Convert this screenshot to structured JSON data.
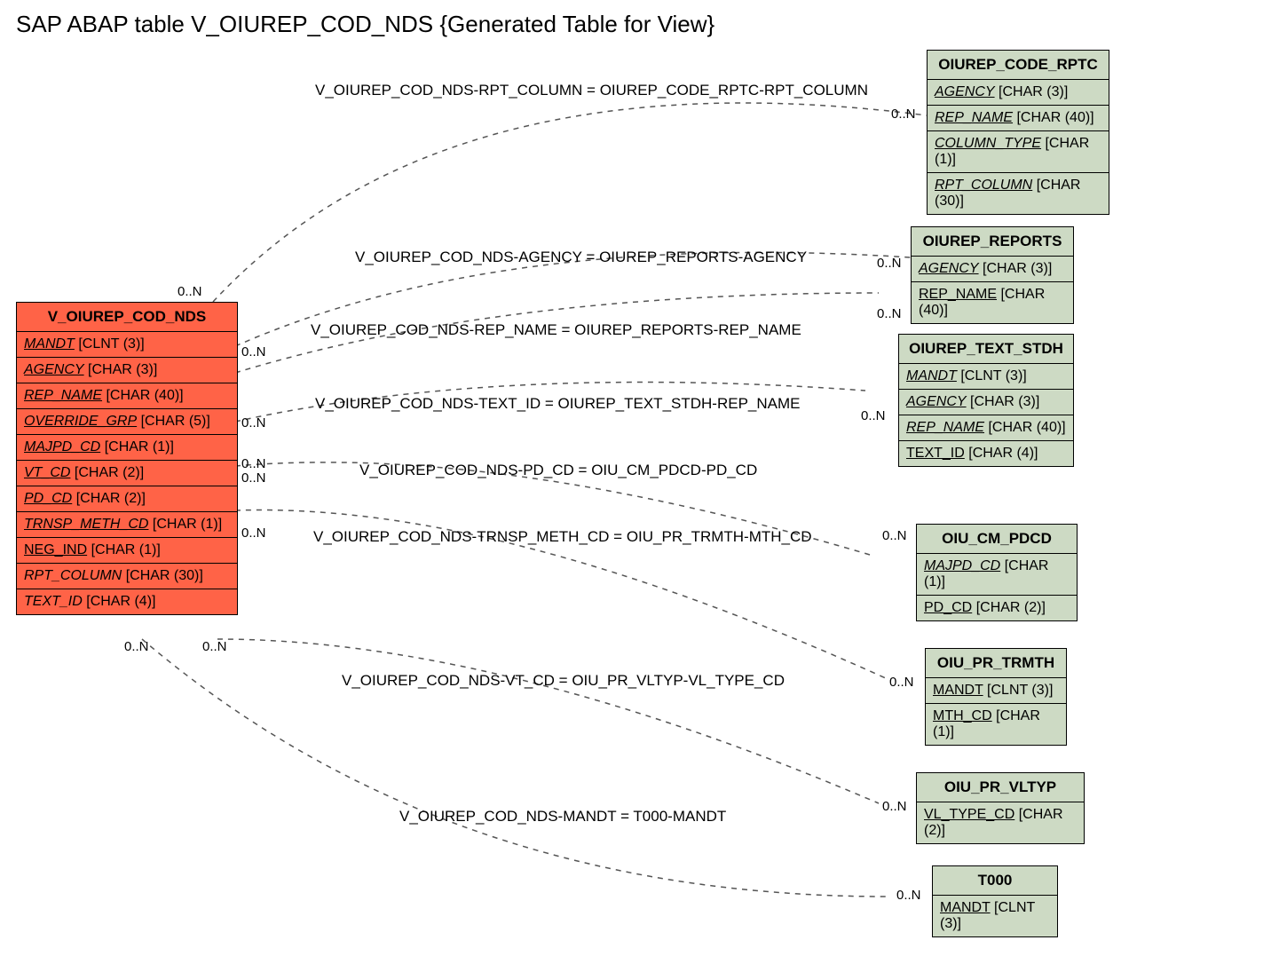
{
  "title": "SAP ABAP table V_OIUREP_COD_NDS {Generated Table for View}",
  "main_entity": {
    "name": "V_OIUREP_COD_NDS",
    "fields": [
      {
        "name": "MANDT",
        "type": "[CLNT (3)]",
        "key": true
      },
      {
        "name": "AGENCY",
        "type": "[CHAR (3)]",
        "key": true
      },
      {
        "name": "REP_NAME",
        "type": "[CHAR (40)]",
        "key": true
      },
      {
        "name": "OVERRIDE_GRP",
        "type": "[CHAR (5)]",
        "key": true
      },
      {
        "name": "MAJPD_CD",
        "type": "[CHAR (1)]",
        "key": true
      },
      {
        "name": "VT_CD",
        "type": "[CHAR (2)]",
        "key": true
      },
      {
        "name": "PD_CD",
        "type": "[CHAR (2)]",
        "key": true
      },
      {
        "name": "TRNSP_METH_CD",
        "type": "[CHAR (1)]",
        "key": true
      },
      {
        "name": "NEG_IND",
        "type": "[CHAR (1)]",
        "key": true
      },
      {
        "name": "RPT_COLUMN",
        "type": "[CHAR (30)]",
        "key": false
      },
      {
        "name": "TEXT_ID",
        "type": "[CHAR (4)]",
        "key": false
      }
    ]
  },
  "ref_entities": {
    "rptc": {
      "name": "OIUREP_CODE_RPTC",
      "fields": [
        {
          "name": "AGENCY",
          "type": "[CHAR (3)]",
          "key": true
        },
        {
          "name": "REP_NAME",
          "type": "[CHAR (40)]",
          "key": true
        },
        {
          "name": "COLUMN_TYPE",
          "type": "[CHAR (1)]",
          "key": true
        },
        {
          "name": "RPT_COLUMN",
          "type": "[CHAR (30)]",
          "key": true
        }
      ]
    },
    "reports": {
      "name": "OIUREP_REPORTS",
      "fields": [
        {
          "name": "AGENCY",
          "type": "[CHAR (3)]",
          "key": true
        },
        {
          "name": "REP_NAME",
          "type": "[CHAR (40)]",
          "key": true
        }
      ]
    },
    "stdh": {
      "name": "OIUREP_TEXT_STDH",
      "fields": [
        {
          "name": "MANDT",
          "type": "[CLNT (3)]",
          "key": true
        },
        {
          "name": "AGENCY",
          "type": "[CHAR (3)]",
          "key": true
        },
        {
          "name": "REP_NAME",
          "type": "[CHAR (40)]",
          "key": true
        },
        {
          "name": "TEXT_ID",
          "type": "[CHAR (4)]",
          "key": true
        }
      ]
    },
    "pdcd": {
      "name": "OIU_CM_PDCD",
      "fields": [
        {
          "name": "MAJPD_CD",
          "type": "[CHAR (1)]",
          "key": true
        },
        {
          "name": "PD_CD",
          "type": "[CHAR (2)]",
          "key": true
        }
      ]
    },
    "trmth": {
      "name": "OIU_PR_TRMTH",
      "fields": [
        {
          "name": "MANDT",
          "type": "[CLNT (3)]",
          "key": true
        },
        {
          "name": "MTH_CD",
          "type": "[CHAR (1)]",
          "key": true
        }
      ]
    },
    "vltyp": {
      "name": "OIU_PR_VLTYP",
      "fields": [
        {
          "name": "VL_TYPE_CD",
          "type": "[CHAR (2)]",
          "key": true
        }
      ]
    },
    "t000": {
      "name": "T000",
      "fields": [
        {
          "name": "MANDT",
          "type": "[CLNT (3)]",
          "key": true
        }
      ]
    }
  },
  "relations": {
    "r1": "V_OIUREP_COD_NDS-RPT_COLUMN = OIUREP_CODE_RPTC-RPT_COLUMN",
    "r2": "V_OIUREP_COD_NDS-AGENCY = OIUREP_REPORTS-AGENCY",
    "r3": "V_OIUREP_COD_NDS-REP_NAME = OIUREP_REPORTS-REP_NAME",
    "r4": "V_OIUREP_COD_NDS-TEXT_ID = OIUREP_TEXT_STDH-REP_NAME",
    "r5": "V_OIUREP_COD_NDS-PD_CD = OIU_CM_PDCD-PD_CD",
    "r6": "V_OIUREP_COD_NDS-TRNSP_METH_CD = OIU_PR_TRMTH-MTH_CD",
    "r7": "V_OIUREP_COD_NDS-VT_CD = OIU_PR_VLTYP-VL_TYPE_CD",
    "r8": "V_OIUREP_COD_NDS-MANDT = T000-MANDT"
  },
  "cardinality": "0..N"
}
